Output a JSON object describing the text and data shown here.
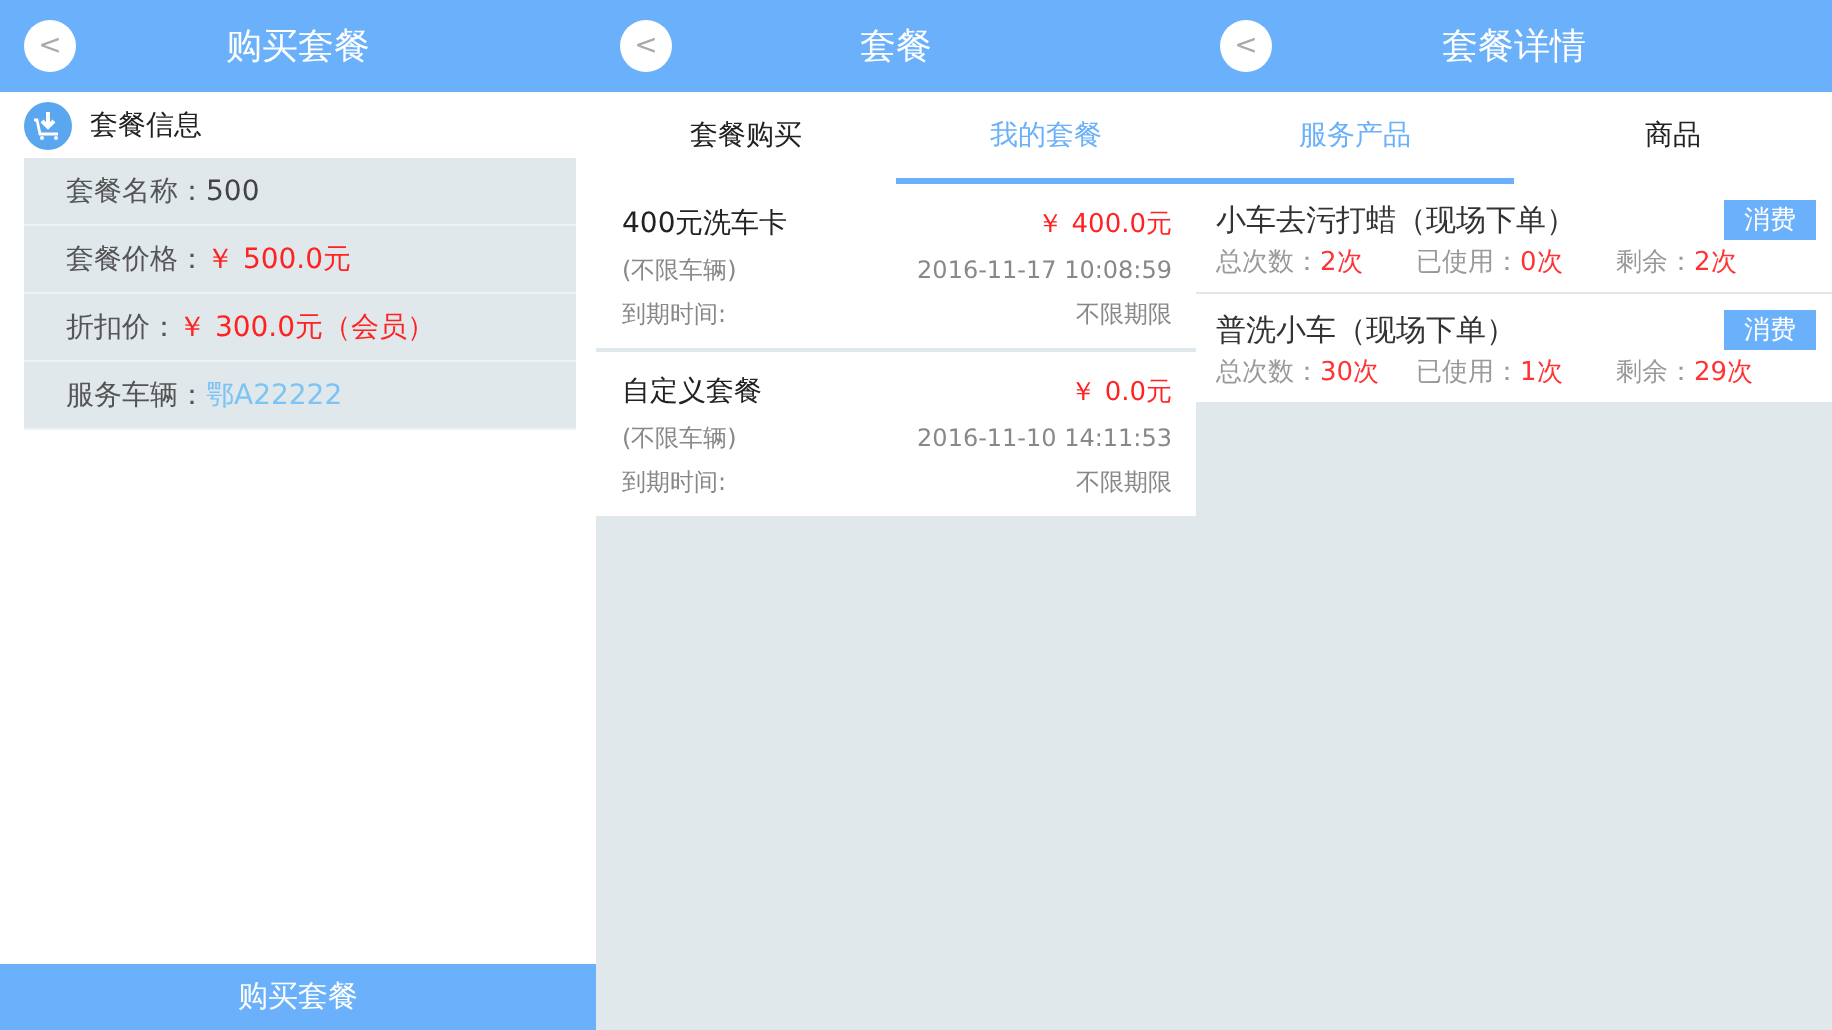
{
  "purchase": {
    "title": "购买套餐",
    "back": "<",
    "section": "套餐信息",
    "rows": [
      {
        "label": "套餐名称：",
        "value": "500",
        "kind": "text"
      },
      {
        "label": "套餐价格：",
        "value": "￥ 500.0元",
        "kind": "price"
      },
      {
        "label": "折扣价：",
        "value": "￥ 300.0元（会员）",
        "kind": "price"
      },
      {
        "label": "服务车辆：",
        "value": "鄂A22222",
        "kind": "plate"
      }
    ],
    "button": "购买套餐"
  },
  "packages": {
    "title": "套餐",
    "back": "<",
    "tabs": [
      {
        "label": "套餐购买",
        "selected": false
      },
      {
        "label": "我的套餐",
        "selected": true
      }
    ],
    "cards": [
      {
        "name": "400元洗车卡",
        "price": "￥ 400.0元",
        "scope": "(不限车辆)",
        "date": "2016-11-17 10:08:59",
        "expiry_label": "到期时间:",
        "expiry": "不限期限"
      },
      {
        "name": "自定义套餐",
        "price": "￥ 0.0元",
        "scope": "(不限车辆)",
        "date": "2016-11-10 14:11:53",
        "expiry_label": "到期时间:",
        "expiry": "不限期限"
      }
    ]
  },
  "details": {
    "title": "套餐详情",
    "back": "<",
    "tabs": [
      {
        "label": "服务产品",
        "selected": true
      },
      {
        "label": "商品",
        "selected": false
      }
    ],
    "items": [
      {
        "name": "小车去污打蜡（现场下单）",
        "action": "消费",
        "total_label": "总次数：",
        "total": "2次",
        "used_label": "已使用：",
        "used": "0次",
        "left_label": "剩余：",
        "left": "2次"
      },
      {
        "name": "普洗小车（现场下单）",
        "action": "消费",
        "total_label": "总次数：",
        "total": "30次",
        "used_label": "已使用：",
        "used": "1次",
        "left_label": "剩余：",
        "left": "29次"
      }
    ]
  }
}
